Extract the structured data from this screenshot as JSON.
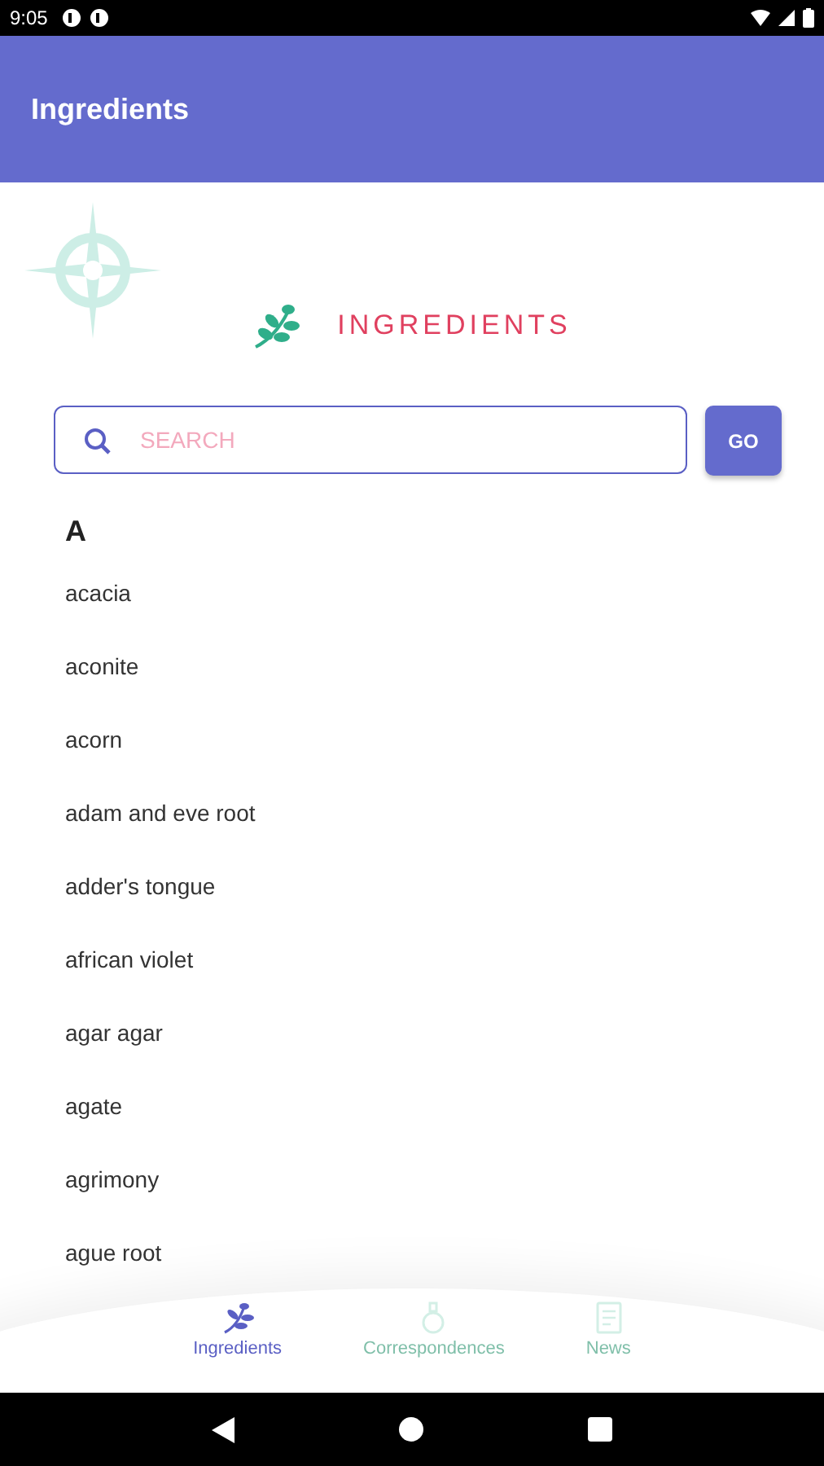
{
  "status_bar": {
    "time": "9:05"
  },
  "app_bar": {
    "title": "Ingredients"
  },
  "header": {
    "title": "INGREDIENTS"
  },
  "search": {
    "placeholder": "SEARCH",
    "button": "GO"
  },
  "section": {
    "letter": "A",
    "items": [
      "acacia",
      "aconite",
      "acorn",
      "adam and eve root",
      "adder's tongue",
      "african violet",
      "agar agar",
      "agate",
      "agrimony",
      "ague root"
    ]
  },
  "bottom_nav": [
    {
      "label": "Ingredients",
      "kind": "leaf",
      "selected": true
    },
    {
      "label": "Correspondences",
      "kind": "potion",
      "selected": false
    },
    {
      "label": "News",
      "kind": "news",
      "selected": false
    }
  ]
}
